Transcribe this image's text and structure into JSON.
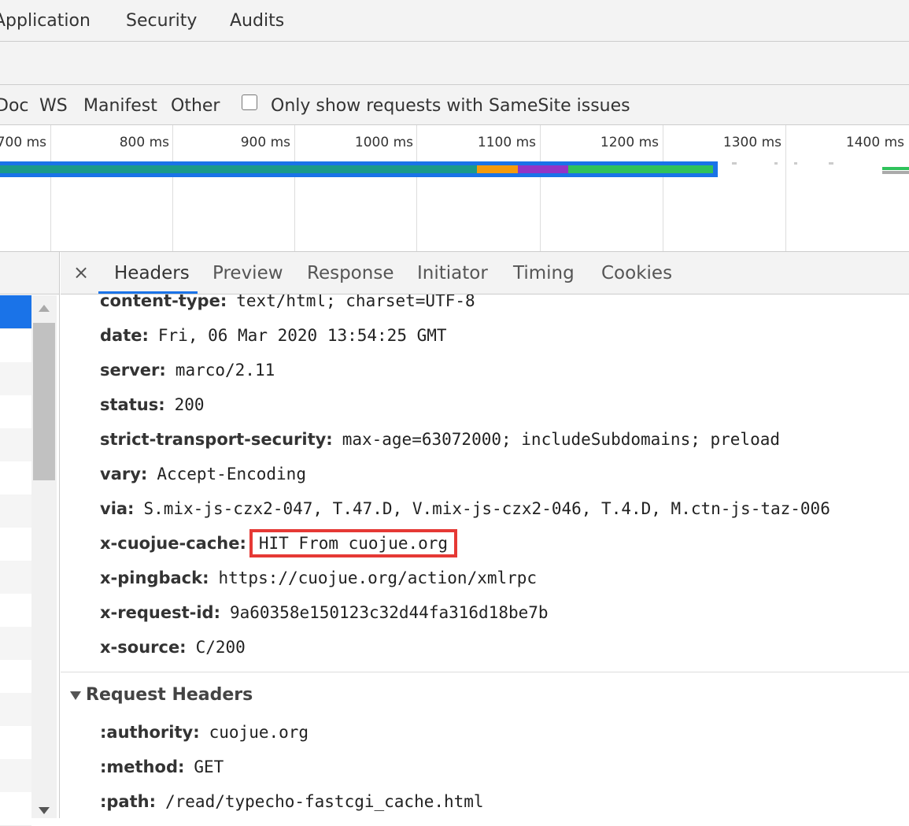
{
  "top_tabs": [
    "Application",
    "Security",
    "Audits"
  ],
  "filters": [
    "Doc",
    "WS",
    "Manifest",
    "Other"
  ],
  "samesite_label": "Only show requests with SameSite issues",
  "timeline": {
    "ticks": [
      "700 ms",
      "800 ms",
      "900 ms",
      "1000 ms",
      "1100 ms",
      "1200 ms",
      "1300 ms",
      "1400 ms"
    ],
    "colors": {
      "blue": "#1a73e8",
      "teal": "#1a9a8a",
      "orange": "#f59b0d",
      "purple": "#9334c6",
      "green": "#2fc25b"
    }
  },
  "detail_tabs": [
    "Headers",
    "Preview",
    "Response",
    "Initiator",
    "Timing",
    "Cookies"
  ],
  "close_glyph": "×",
  "response_headers": [
    {
      "name": "content-type:",
      "value": "text/html; charset=UTF-8"
    },
    {
      "name": "date:",
      "value": "Fri, 06 Mar 2020 13:54:25 GMT"
    },
    {
      "name": "server:",
      "value": "marco/2.11"
    },
    {
      "name": "status:",
      "value": "200"
    },
    {
      "name": "strict-transport-security:",
      "value": "max-age=63072000; includeSubdomains; preload"
    },
    {
      "name": "vary:",
      "value": "Accept-Encoding"
    },
    {
      "name": "via:",
      "value": "S.mix-js-czx2-047, T.47.D, V.mix-js-czx2-046, T.4.D, M.ctn-js-taz-006"
    },
    {
      "name": "x-cuojue-cache:",
      "value": "HIT From cuojue.org"
    },
    {
      "name": "x-pingback:",
      "value": "https://cuojue.org/action/xmlrpc"
    },
    {
      "name": "x-request-id:",
      "value": "9a60358e150123c32d44fa316d18be7b"
    },
    {
      "name": "x-source:",
      "value": "C/200"
    }
  ],
  "request_section_title": "Request Headers",
  "request_headers": [
    {
      "name": ":authority:",
      "value": "cuojue.org"
    },
    {
      "name": ":method:",
      "value": "GET"
    },
    {
      "name": ":path:",
      "value": "/read/typecho-fastcgi_cache.html"
    }
  ]
}
